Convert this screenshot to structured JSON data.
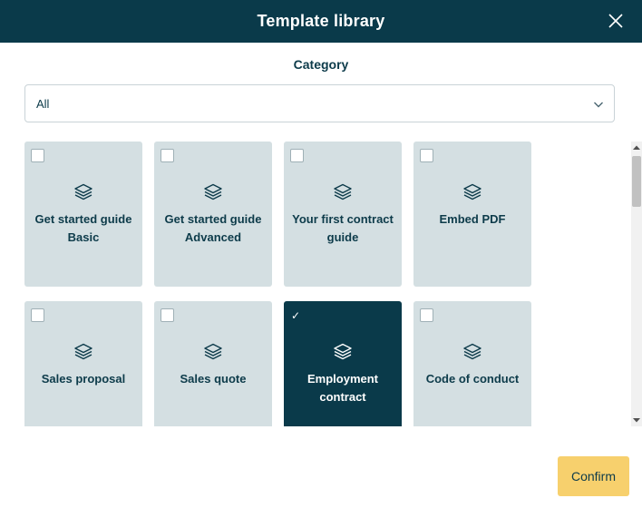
{
  "header": {
    "title": "Template library",
    "close_icon": "close-icon"
  },
  "category": {
    "label": "Category",
    "selected": "All",
    "chevron_icon": "chevron-down-icon"
  },
  "templates": [
    {
      "title": "Get started guide Basic",
      "selected": false,
      "icon": "layers-icon"
    },
    {
      "title": "Get started guide Advanced",
      "selected": false,
      "icon": "layers-icon"
    },
    {
      "title": "Your first contract guide",
      "selected": false,
      "icon": "layers-icon"
    },
    {
      "title": "Embed PDF",
      "selected": false,
      "icon": "layers-icon"
    },
    {
      "title": "Sales proposal",
      "selected": false,
      "icon": "layers-icon"
    },
    {
      "title": "Sales quote",
      "selected": false,
      "icon": "layers-icon"
    },
    {
      "title": "Employment contract",
      "selected": true,
      "icon": "layers-icon"
    },
    {
      "title": "Code of conduct",
      "selected": false,
      "icon": "layers-icon"
    }
  ],
  "footer": {
    "confirm_label": "Confirm"
  },
  "colors": {
    "header_bg": "#0a3a4a",
    "card_bg": "#d4dfe2",
    "card_selected_bg": "#0a3a4a",
    "confirm_bg": "#f7d06d",
    "text": "#0d3b4a"
  }
}
